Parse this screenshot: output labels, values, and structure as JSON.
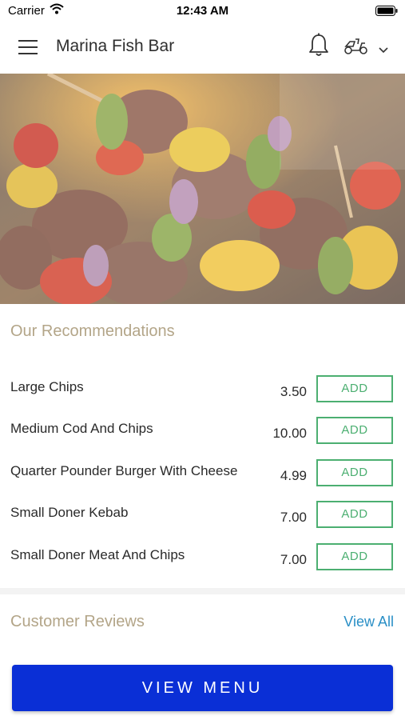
{
  "status_bar": {
    "carrier": "Carrier",
    "time": "12:43 AM"
  },
  "header": {
    "title": "Marina Fish Bar"
  },
  "icons": {
    "menu": "hamburger-icon",
    "bell": "bell-icon",
    "delivery": "scooter-icon",
    "dropdown": "chevron-down-icon"
  },
  "recommendations": {
    "title": "Our Recommendations",
    "items": [
      {
        "name": "Large Chips",
        "price": "3.50",
        "button": "ADD"
      },
      {
        "name": "Medium Cod And Chips",
        "price": "10.00",
        "button": "ADD"
      },
      {
        "name": "Quarter Pounder Burger With Cheese",
        "price": "4.99",
        "button": "ADD"
      },
      {
        "name": "Small Doner Kebab",
        "price": "7.00",
        "button": "ADD"
      },
      {
        "name": "Small Doner Meat And Chips",
        "price": "7.00",
        "button": "ADD"
      }
    ]
  },
  "reviews": {
    "title": "Customer Reviews",
    "view_all": "View All"
  },
  "view_menu_button": "VIEW MENU",
  "colors": {
    "accent_gold": "#b3a588",
    "add_green": "#4caf71",
    "link_blue": "#2a8fc6",
    "primary_blue": "#0a2fd6"
  }
}
